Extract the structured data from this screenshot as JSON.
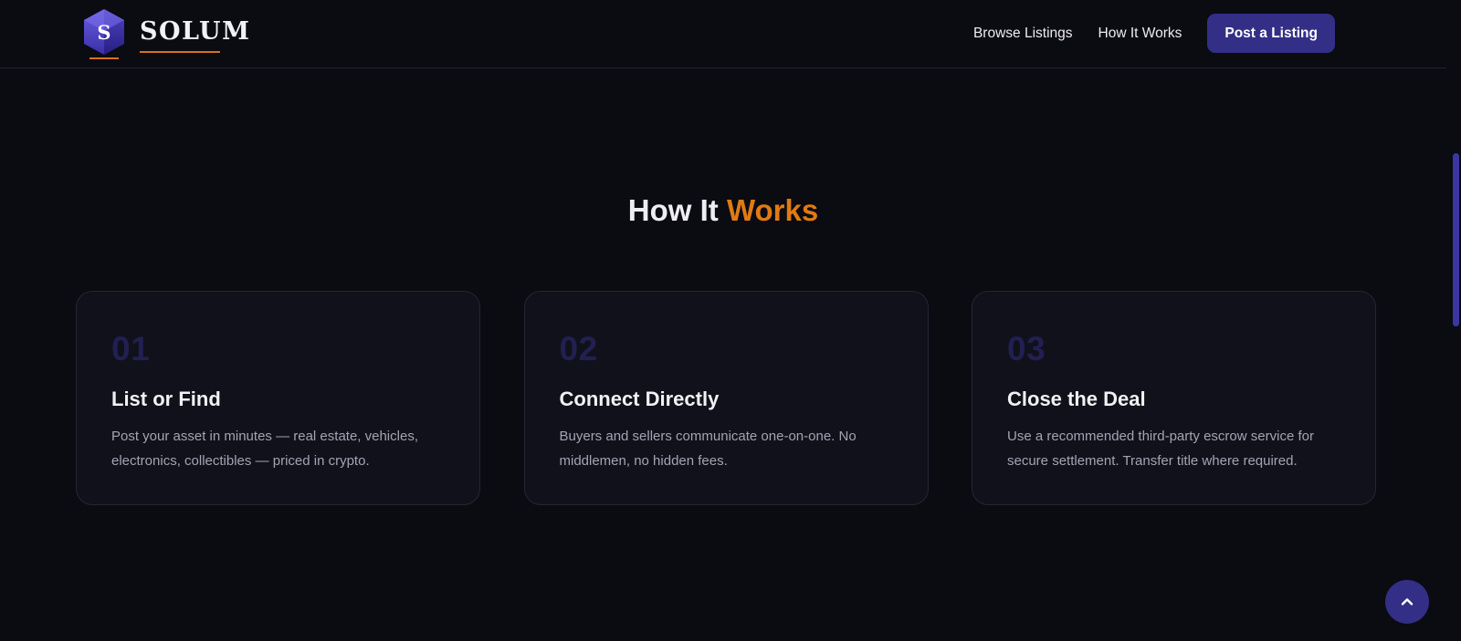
{
  "brand": {
    "name": "SOLUM",
    "mark_letter": "S"
  },
  "nav": {
    "links": [
      "Browse Listings",
      "How It Works"
    ],
    "cta_label": "Post a Listing"
  },
  "section": {
    "title_prefix": "How It",
    "title_accent": "Works"
  },
  "steps": [
    {
      "number": "01",
      "title": "List or Find",
      "description": "Post your asset in minutes — real estate, vehicles, electronics, collectibles — priced in crypto."
    },
    {
      "number": "02",
      "title": "Connect Directly",
      "description": "Buyers and sellers communicate one-on-one. No middlemen, no hidden fees."
    },
    {
      "number": "03",
      "title": "Close the Deal",
      "description": "Use a recommended third-party escrow service for secure settlement. Transfer title where required."
    }
  ],
  "icons": {
    "logo": "hexagon-logo-icon",
    "back_to_top": "chevron-up-icon"
  },
  "colors": {
    "background": "#0b0b12",
    "accent_orange": "#e07a12",
    "brand_indigo": "#332f86",
    "card_background": "#11111b",
    "step_number": "#221f52"
  }
}
